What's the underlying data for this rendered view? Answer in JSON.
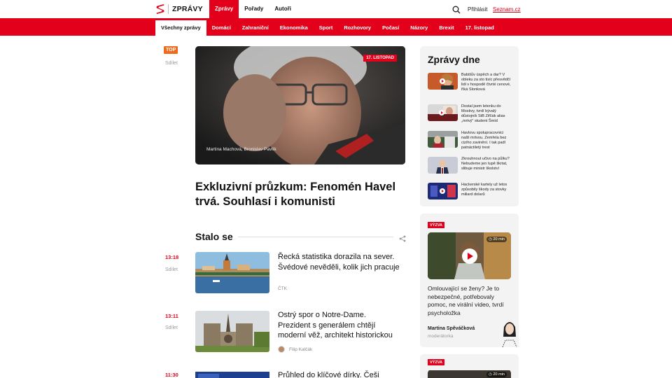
{
  "header": {
    "logo_text": "ZPRÁVY",
    "main_nav": [
      "Zprávy",
      "Pořady",
      "Autoři"
    ],
    "login": "Přihlásit",
    "seznam_link": "Seznam.cz"
  },
  "subnav": [
    "Všechny zprávy",
    "Domácí",
    "Zahraniční",
    "Ekonomika",
    "Sport",
    "Rozhovory",
    "Počasí",
    "Názory",
    "Brexit",
    "17. listopad"
  ],
  "hero": {
    "badge": "TOP",
    "share": "Sdílet",
    "image_badge": "17. LISTOPAD",
    "caption": "Martina Machová, Bronislav Pavlík",
    "title": "Exkluzivní průzkum: Fenomén Havel trvá. Souhlasí i komunisti"
  },
  "stalo_se": {
    "title": "Stalo se",
    "items": [
      {
        "time": "13:18",
        "share": "Sdílet",
        "title": "Řecká statistika dorazila na sever. Švédové nevěděli, kolik jich pracuje",
        "source": "ČTK"
      },
      {
        "time": "13:11",
        "share": "Sdílet",
        "title": "Ostrý spor o Notre-Dame. Prezident s generálem chtějí moderní věž, architekt historickou",
        "source": "Filip Kalčák"
      },
      {
        "time": "11:30",
        "title": "Průhled do klíčové dírky. Češi vyrobili"
      }
    ]
  },
  "zpravy_dne": {
    "title": "Zprávy dne",
    "items": [
      "Babišův úspěch a dar? V obleku za sto tisíc přesvědčí lidi v hospodě čtvrté cenové, říká Slonková",
      "Dostal jsem letenku do Moskvy, tvrdí bývalý důstojník StB Zifčák alias „mrtvý“ student Šmíd",
      "Havlovu spolupracovnici našli mrtvou. Zemřela bez cizího zavinění. I tak padl patnáctiletý trest",
      "Zkrouhnout učivo na půlku? Nebudeme jen tupě škrtat, slibuje ministr školství",
      "Hackerské kartely už letos způsobily škody za stovky miliard dolarů"
    ]
  },
  "vyzva": {
    "badge": "VÝZVA",
    "duration": "20 min",
    "text": "Omlouvající se ženy? Je to nebezpečné, potřebovaly pomoc, ne virální video, tvrdí psycholožka",
    "author": "Martina Spěváčková",
    "role": "moderátorka",
    "badge2": "VÝZVA",
    "duration2": "20 min"
  },
  "colors": {
    "brand_red": "#e2001a",
    "top_orange": "#f06a1d",
    "card_bg": "#f3f3f3"
  },
  "icons": [
    "seznam-s-logo-icon",
    "search-icon",
    "share-icon",
    "play-icon",
    "clock-icon"
  ]
}
